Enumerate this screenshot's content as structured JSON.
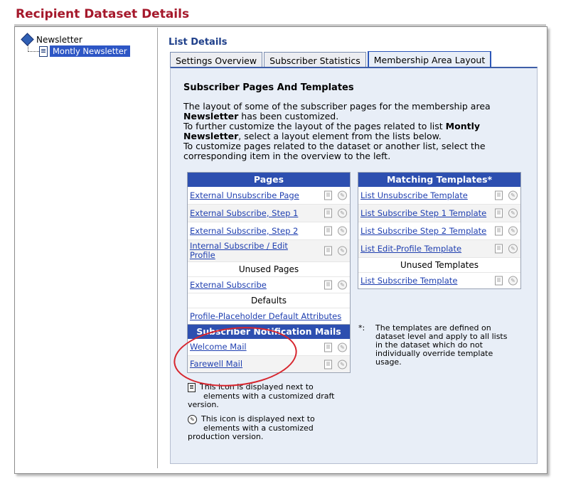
{
  "title": "Recipient Dataset Details",
  "tree": {
    "root_label": "Newsletter",
    "child_label": "Montly Newsletter"
  },
  "content": {
    "section_title": "List Details",
    "tabs": [
      "Settings Overview",
      "Subscriber Statistics",
      "Membership Area Layout"
    ],
    "heading": "Subscriber Pages And Templates",
    "desc_1": "The layout of some of the subscriber pages for the membership area",
    "desc_bold_1": "Newsletter",
    "desc_2": " has been customized.",
    "desc_3": "To further customize the layout of the pages related to list ",
    "desc_bold_2": "Montly Newsletter",
    "desc_4": ", select a layout element from the lists below.",
    "desc_5": "To customize pages related to the dataset or another list, select the corresponding item in the overview to the left."
  },
  "pages": {
    "header": "Pages",
    "items": [
      "External Unsubscribe Page",
      "External Subscribe, Step 1",
      "External Subscribe, Step 2",
      "Internal Subscribe / Edit Profile"
    ],
    "unused_label": "Unused Pages",
    "unused_items": [
      "External Subscribe"
    ],
    "defaults_label": "Defaults",
    "defaults_items": [
      "Profile-Placeholder Default Attributes"
    ]
  },
  "templates": {
    "header": "Matching Templates*",
    "items": [
      "List Unsubscribe Template",
      "List Subscribe Step 1 Template",
      "List Subscribe Step 2 Template",
      "List Edit-Profile Template"
    ],
    "unused_label": "Unused Templates",
    "unused_items": [
      "List Subscribe Template"
    ]
  },
  "mails": {
    "header": "Subscriber Notification Mails",
    "items": [
      "Welcome Mail",
      "Farewell Mail"
    ]
  },
  "note": {
    "star": "*:",
    "text": "The templates are defined on dataset level and apply to all lists in the dataset which do not individually override template usage."
  },
  "legend": {
    "draft_1": "This icon is displayed next to",
    "draft_2": "elements with a customized draft",
    "draft_3": "version.",
    "prod_1": "This icon is displayed next to",
    "prod_2": "elements with a customized",
    "prod_3": "production version."
  }
}
